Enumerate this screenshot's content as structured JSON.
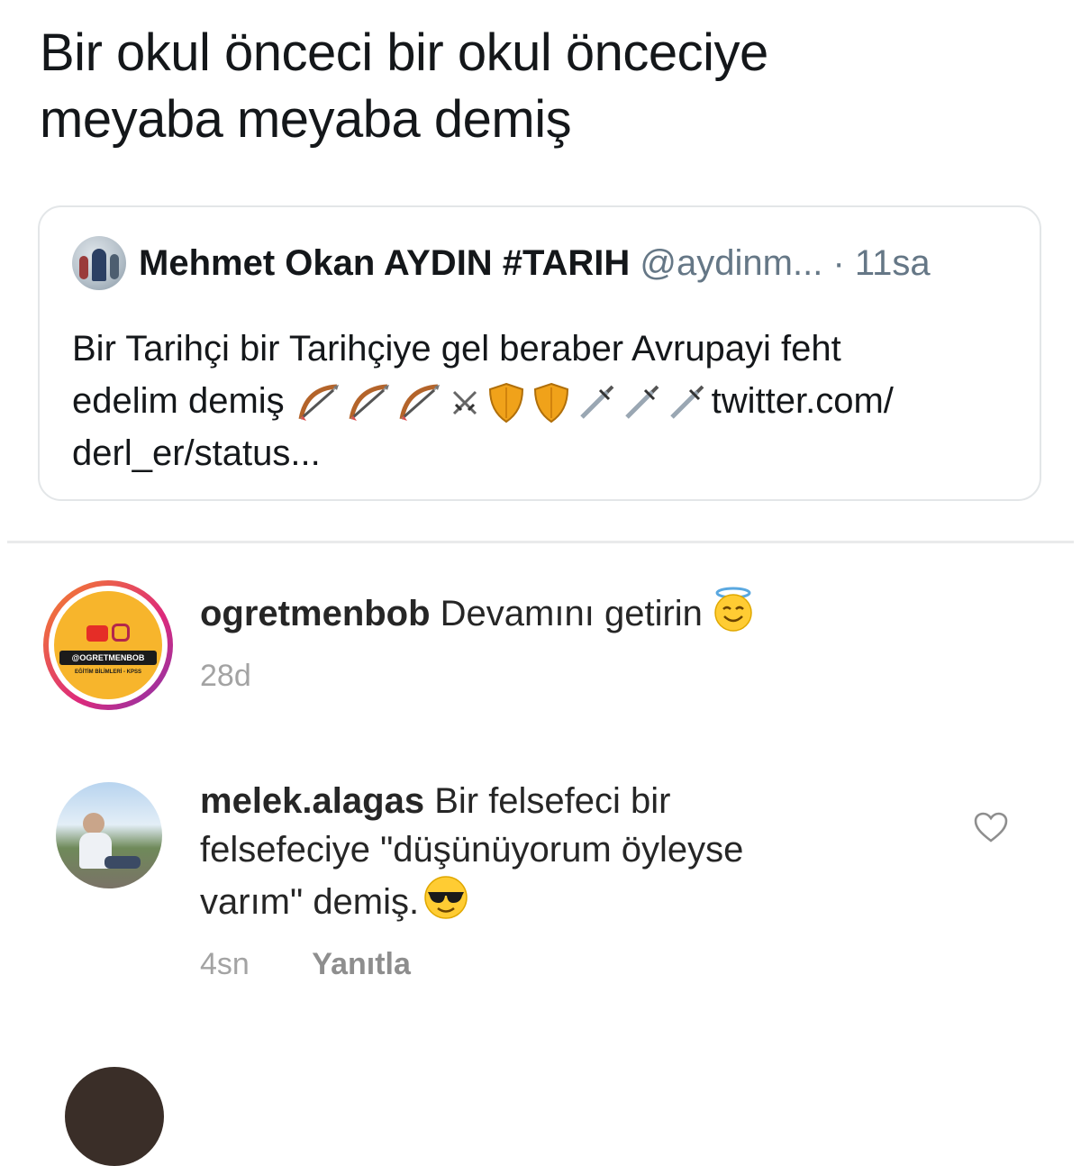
{
  "tweet": {
    "text_line1": "Bir okul önceci bir okul önceciye",
    "text_line2": "meyaba meyaba demiş"
  },
  "quoted_tweet": {
    "author_name": "Mehmet Okan AYDIN #TARIH",
    "handle": "@aydinm...",
    "time": "· 11sa",
    "text_line1": "Bir Tarihçi bir Tarihçiye gel beraber Avrupayi feht",
    "text_line2_before": "edelim demiş",
    "text_line2_after": "twitter.com/",
    "text_line3": "derl_er/status...",
    "emoji_icons": [
      "bow-and-arrow-icon",
      "bow-and-arrow-icon",
      "bow-and-arrow-icon",
      "crossed-swords-icon",
      "shield-icon",
      "shield-icon",
      "dagger-icon",
      "dagger-icon",
      "dagger-icon"
    ]
  },
  "comments": [
    {
      "username": "ogretmenbob",
      "text": "Devamını getirin",
      "emoji": "smiling-face-with-halo-icon",
      "time": "28d",
      "avatar_label": "@OGRETMENBOB",
      "avatar_sublabel": "EĞİTİM BİLİMLERİ - KPSS"
    },
    {
      "username": "melek.alagas",
      "text_line1": "Bir felsefeci bir",
      "text_line2": "felsefeciye \"düşünüyorum öyleyse",
      "text_line3": "varım\" demiş.",
      "emoji": "smiling-face-with-sunglasses-icon",
      "time": "4sn",
      "reply_label": "Yanıtla"
    }
  ],
  "colors": {
    "text": "#262626",
    "secondary": "#a3a3a3",
    "twitter_gray": "#657786",
    "story_ring_start": "#f58529",
    "story_ring_end": "#dd2a7b"
  }
}
